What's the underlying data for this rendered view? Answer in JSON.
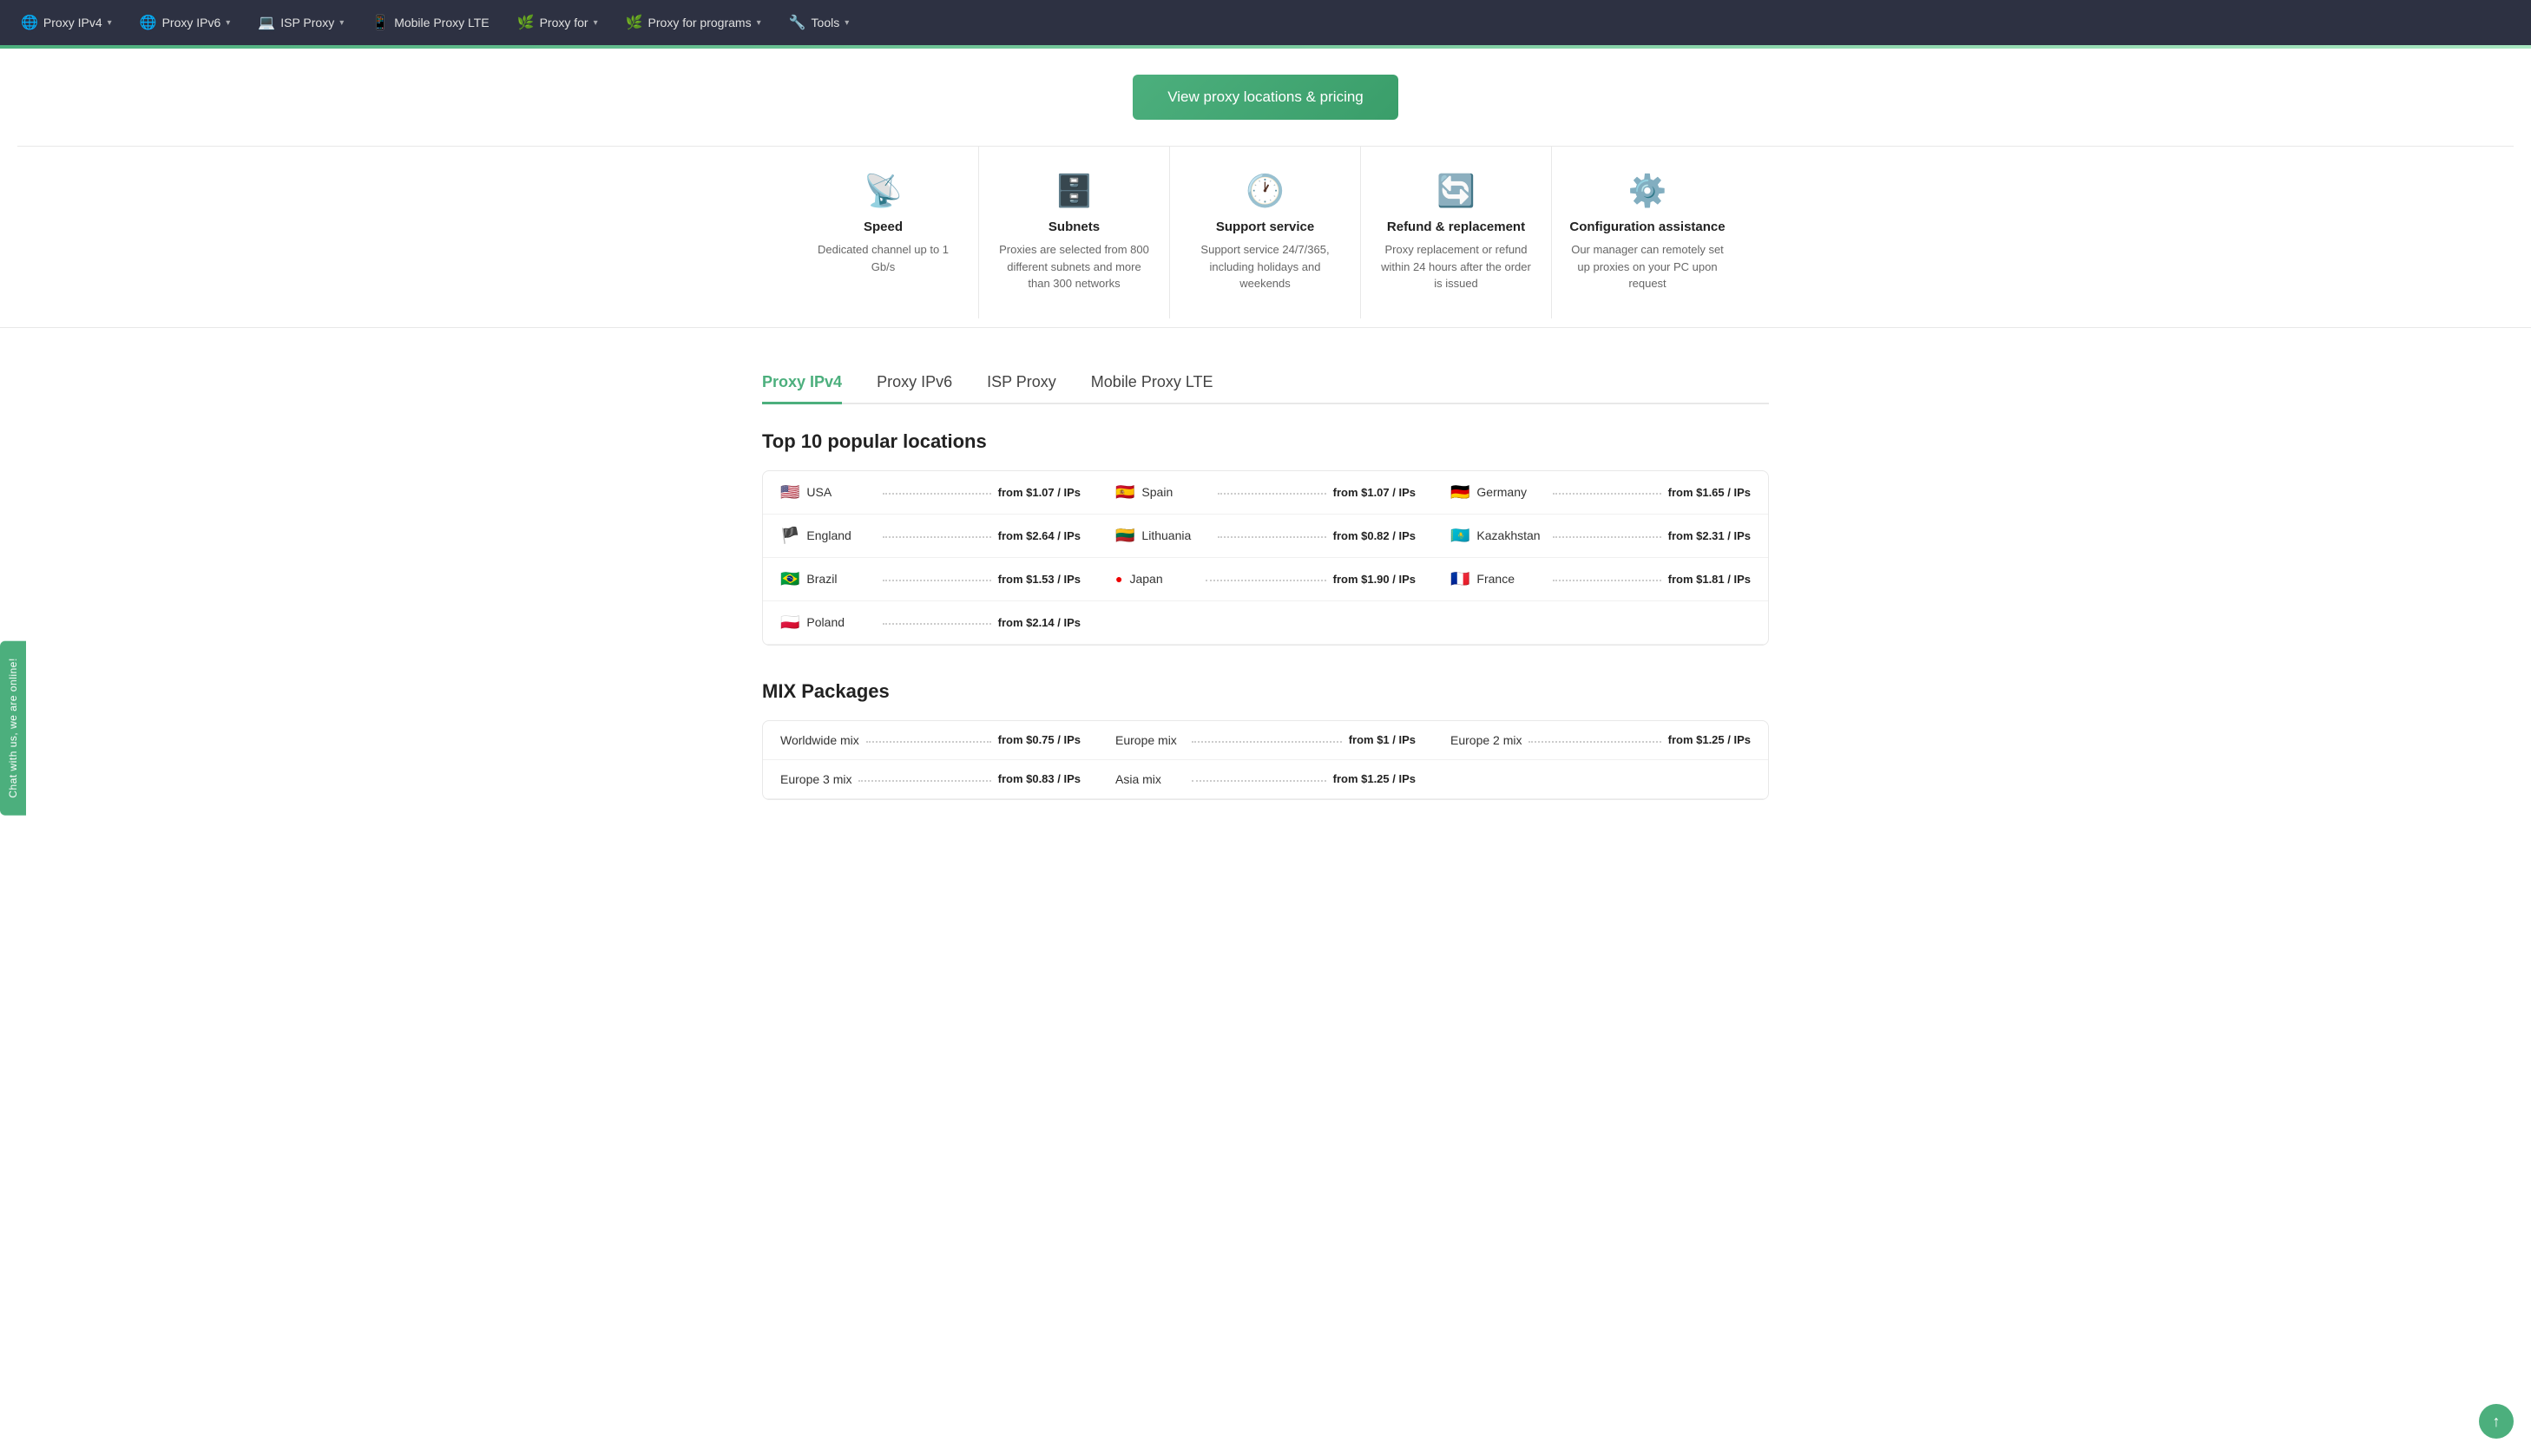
{
  "nav": {
    "items": [
      {
        "label": "Proxy IPv4",
        "icon": "🌐"
      },
      {
        "label": "Proxy IPv6",
        "icon": "🌐"
      },
      {
        "label": "ISP Proxy",
        "icon": "💻"
      },
      {
        "label": "Mobile Proxy LTE",
        "icon": "📱"
      },
      {
        "label": "Proxy for",
        "icon": "🌿"
      },
      {
        "label": "Proxy for programs",
        "icon": "🌿"
      },
      {
        "label": "Tools",
        "icon": "🔧"
      }
    ]
  },
  "hero": {
    "button_label": "View proxy locations & pricing"
  },
  "features": [
    {
      "icon": "📡",
      "title": "Speed",
      "desc": "Dedicated channel up to 1 Gb/s"
    },
    {
      "icon": "🗄️",
      "title": "Subnets",
      "desc": "Proxies are selected from 800 different subnets and more than 300 networks"
    },
    {
      "icon": "🕐",
      "title": "Support service",
      "desc": "Support service 24/7/365, including holidays and weekends"
    },
    {
      "icon": "🔄",
      "title": "Refund & replacement",
      "desc": "Proxy replacement or refund within 24 hours after the order is issued"
    },
    {
      "icon": "⚙️",
      "title": "Configuration assistance",
      "desc": "Our manager can remotely set up proxies on your PC upon request"
    }
  ],
  "tabs": [
    {
      "label": "Proxy IPv4",
      "active": true
    },
    {
      "label": "Proxy IPv6",
      "active": false
    },
    {
      "label": "ISP Proxy",
      "active": false
    },
    {
      "label": "Mobile Proxy LTE",
      "active": false
    }
  ],
  "popular_locations": {
    "title": "Top 10 popular locations",
    "items": [
      {
        "flag": "🇺🇸",
        "name": "USA",
        "price": "from $1.07 / IPs"
      },
      {
        "flag": "🇪🇸",
        "name": "Spain",
        "price": "from $1.07 / IPs"
      },
      {
        "flag": "🇩🇪",
        "name": "Germany",
        "price": "from $1.65 / IPs"
      },
      {
        "flag": "🏴󠁧󠁢󠁥󠁮󠁧󠁿",
        "name": "England",
        "price": "from $2.64 / IPs"
      },
      {
        "flag": "🇱🇹",
        "name": "Lithuania",
        "price": "from $0.82 / IPs"
      },
      {
        "flag": "🇰🇿",
        "name": "Kazakhstan",
        "price": "from $2.31 / IPs"
      },
      {
        "flag": "🇧🇷",
        "name": "Brazil",
        "price": "from $1.53 / IPs"
      },
      {
        "flag": "🔴",
        "name": "Japan",
        "price": "from $1.90 / IPs"
      },
      {
        "flag": "🇫🇷",
        "name": "France",
        "price": "from $1.81 / IPs"
      },
      {
        "flag": "🇵🇱",
        "name": "Poland",
        "price": "from $2.14 / IPs"
      },
      {
        "flag": "",
        "name": "",
        "price": ""
      },
      {
        "flag": "",
        "name": "",
        "price": ""
      }
    ]
  },
  "mix_packages": {
    "title": "MIX Packages",
    "items": [
      {
        "name": "Worldwide mix",
        "price": "from $0.75 / IPs"
      },
      {
        "name": "Europe mix",
        "price": "from $1 / IPs"
      },
      {
        "name": "Europe 2 mix",
        "price": "from $1.25 / IPs"
      },
      {
        "name": "Europe 3 mix",
        "price": "from $0.83 / IPs"
      },
      {
        "name": "Asia mix",
        "price": "from $1.25 / IPs"
      },
      {
        "name": "",
        "price": ""
      }
    ]
  },
  "chat_widget": {
    "label": "Chat with us, we are online!"
  }
}
